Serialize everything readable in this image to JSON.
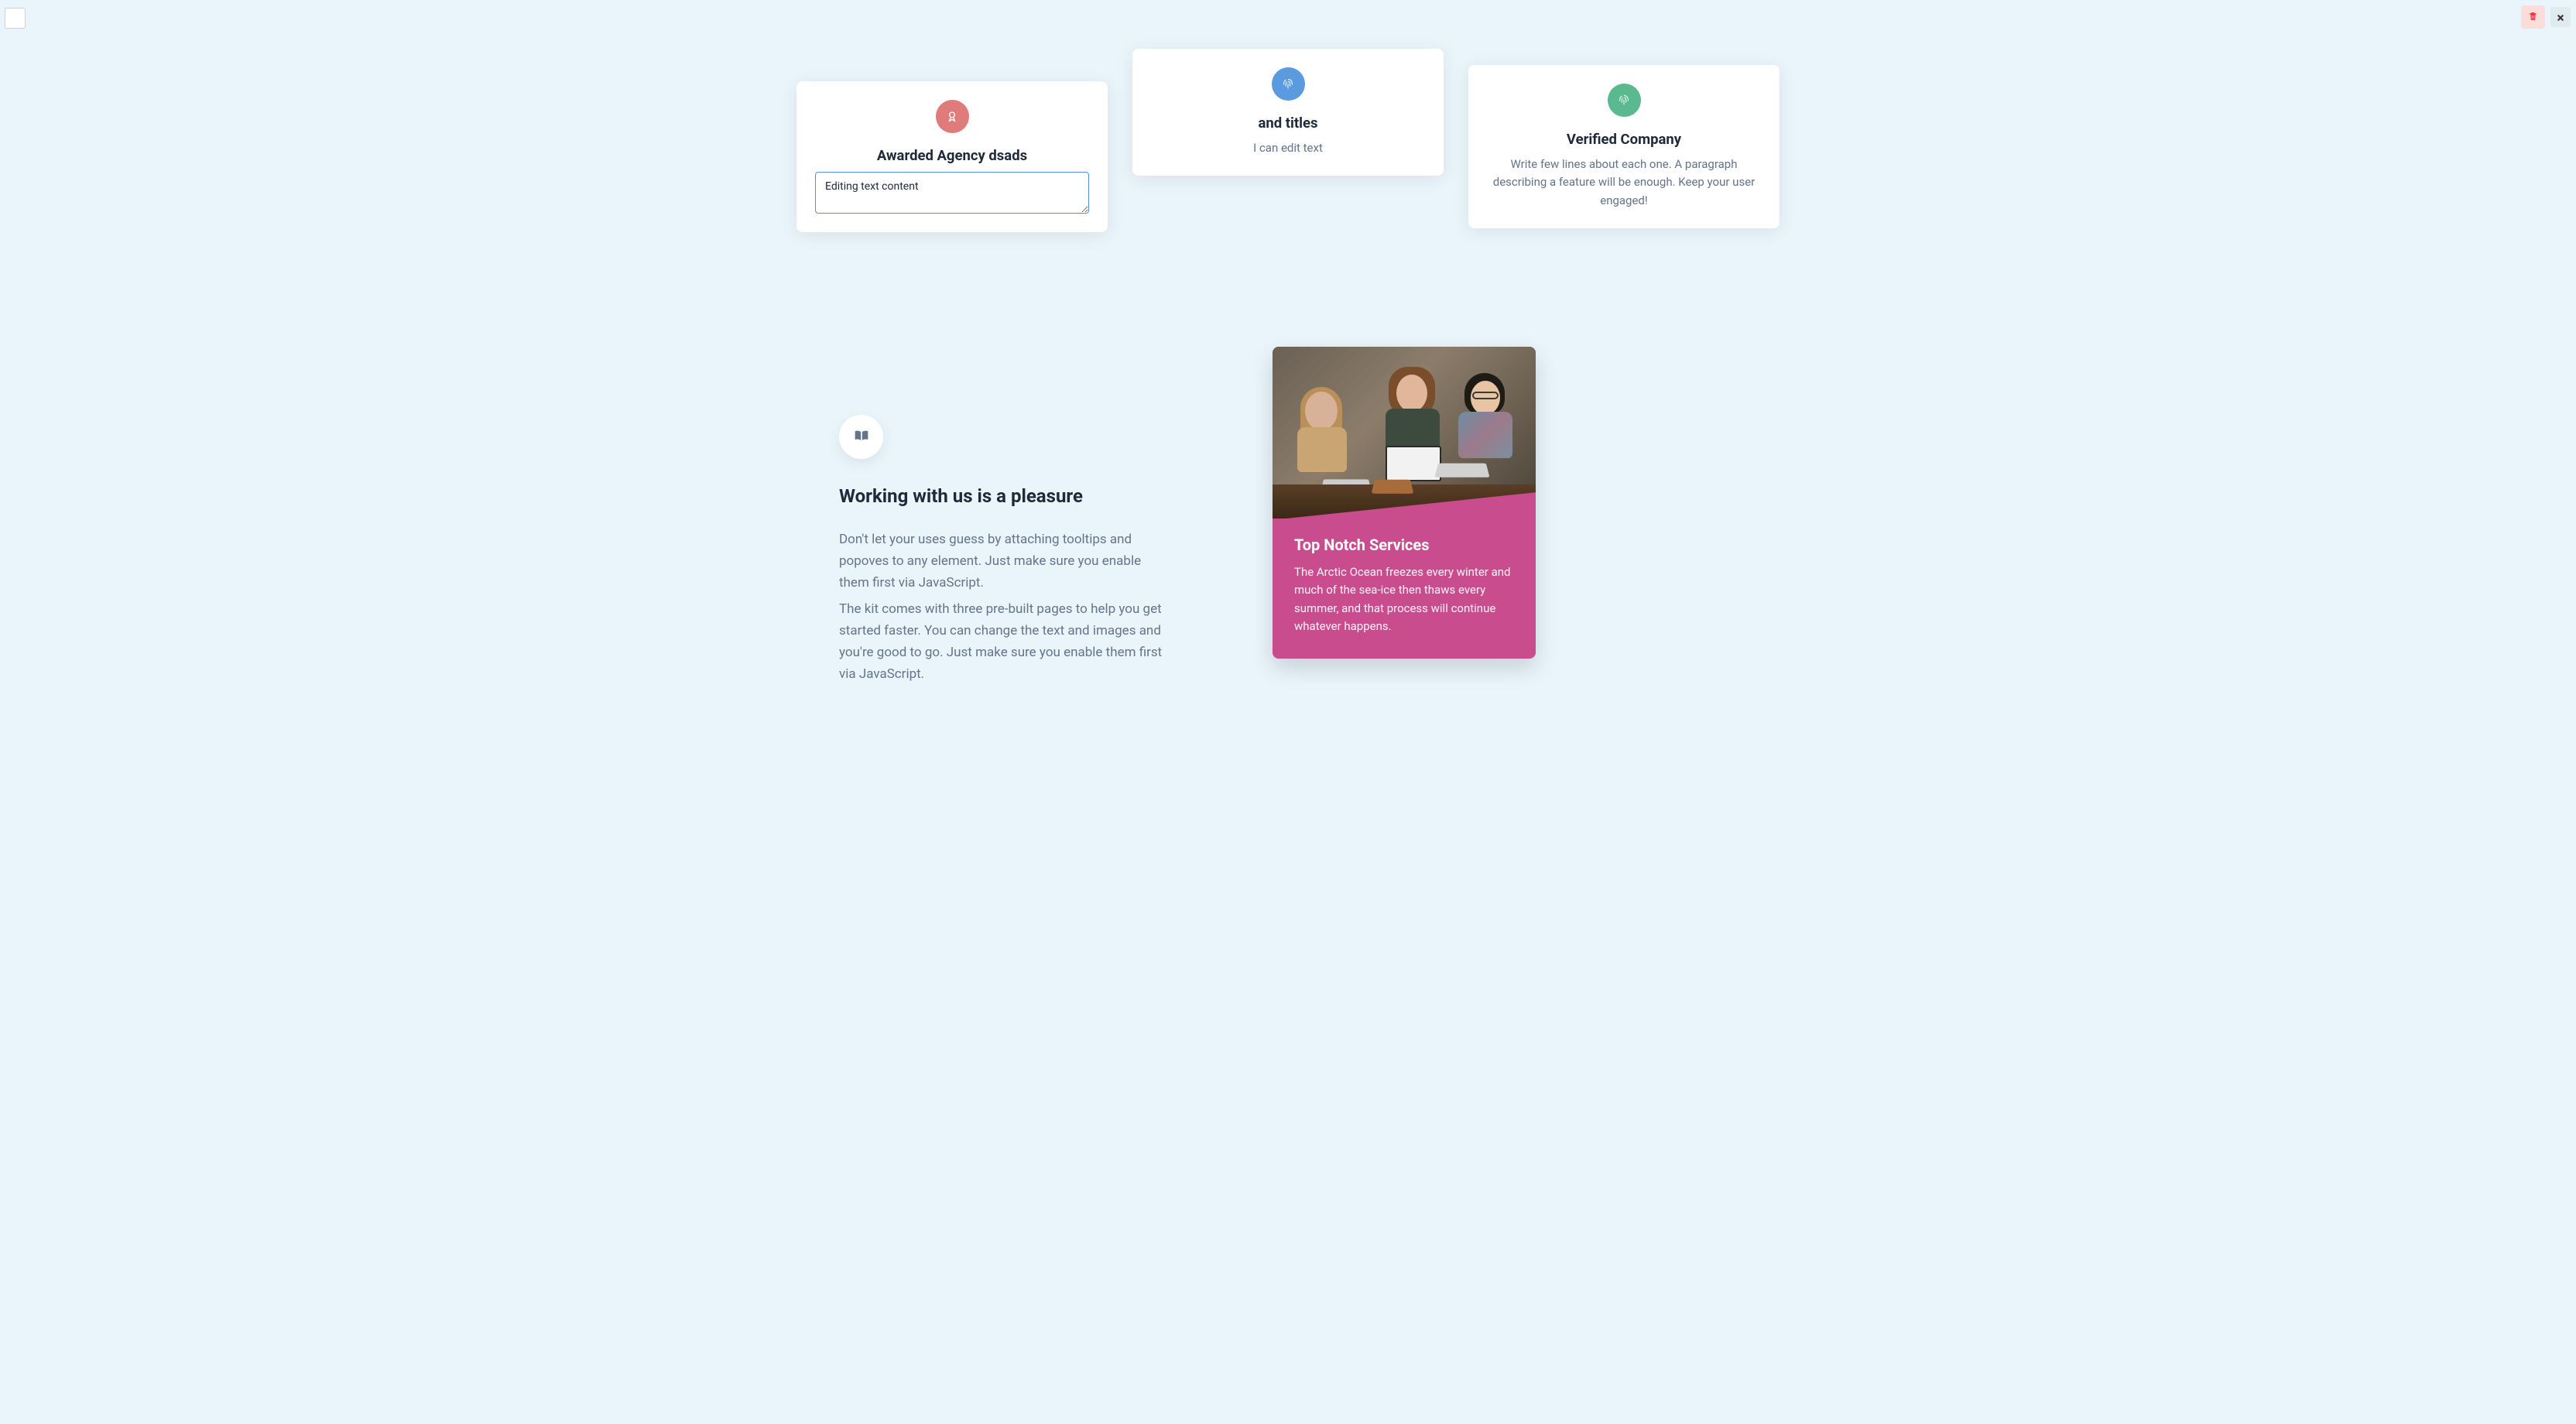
{
  "cards": [
    {
      "title": "Awarded Agency dsads",
      "textarea_value": "Editing text content",
      "icon": "award-icon",
      "color": "red"
    },
    {
      "title": "and titles",
      "text": "I can edit text",
      "icon": "fingerprint-icon",
      "color": "blue"
    },
    {
      "title": "Verified Company",
      "text": "Write few lines about each one. A paragraph describing a feature will be enough. Keep your user engaged!",
      "icon": "fingerprint-icon",
      "color": "green"
    }
  ],
  "left": {
    "heading": "Working with us is a pleasure",
    "para1": "Don't let your uses guess by attaching tooltips and popoves to any element. Just make sure you enable them first via JavaScript.",
    "para2": "The kit comes with three pre-built pages to help you get started faster. You can change the text and images and you're good to go. Just make sure you enable them first via JavaScript."
  },
  "right": {
    "title": "Top Notch Services",
    "para": "The Arctic Ocean freezes every winter and much of the sea-ice then thaws every summer, and that process will continue whatever happens."
  },
  "colors": {
    "accent_pink": "#c94c8e",
    "bg": "#e9f5fb"
  }
}
